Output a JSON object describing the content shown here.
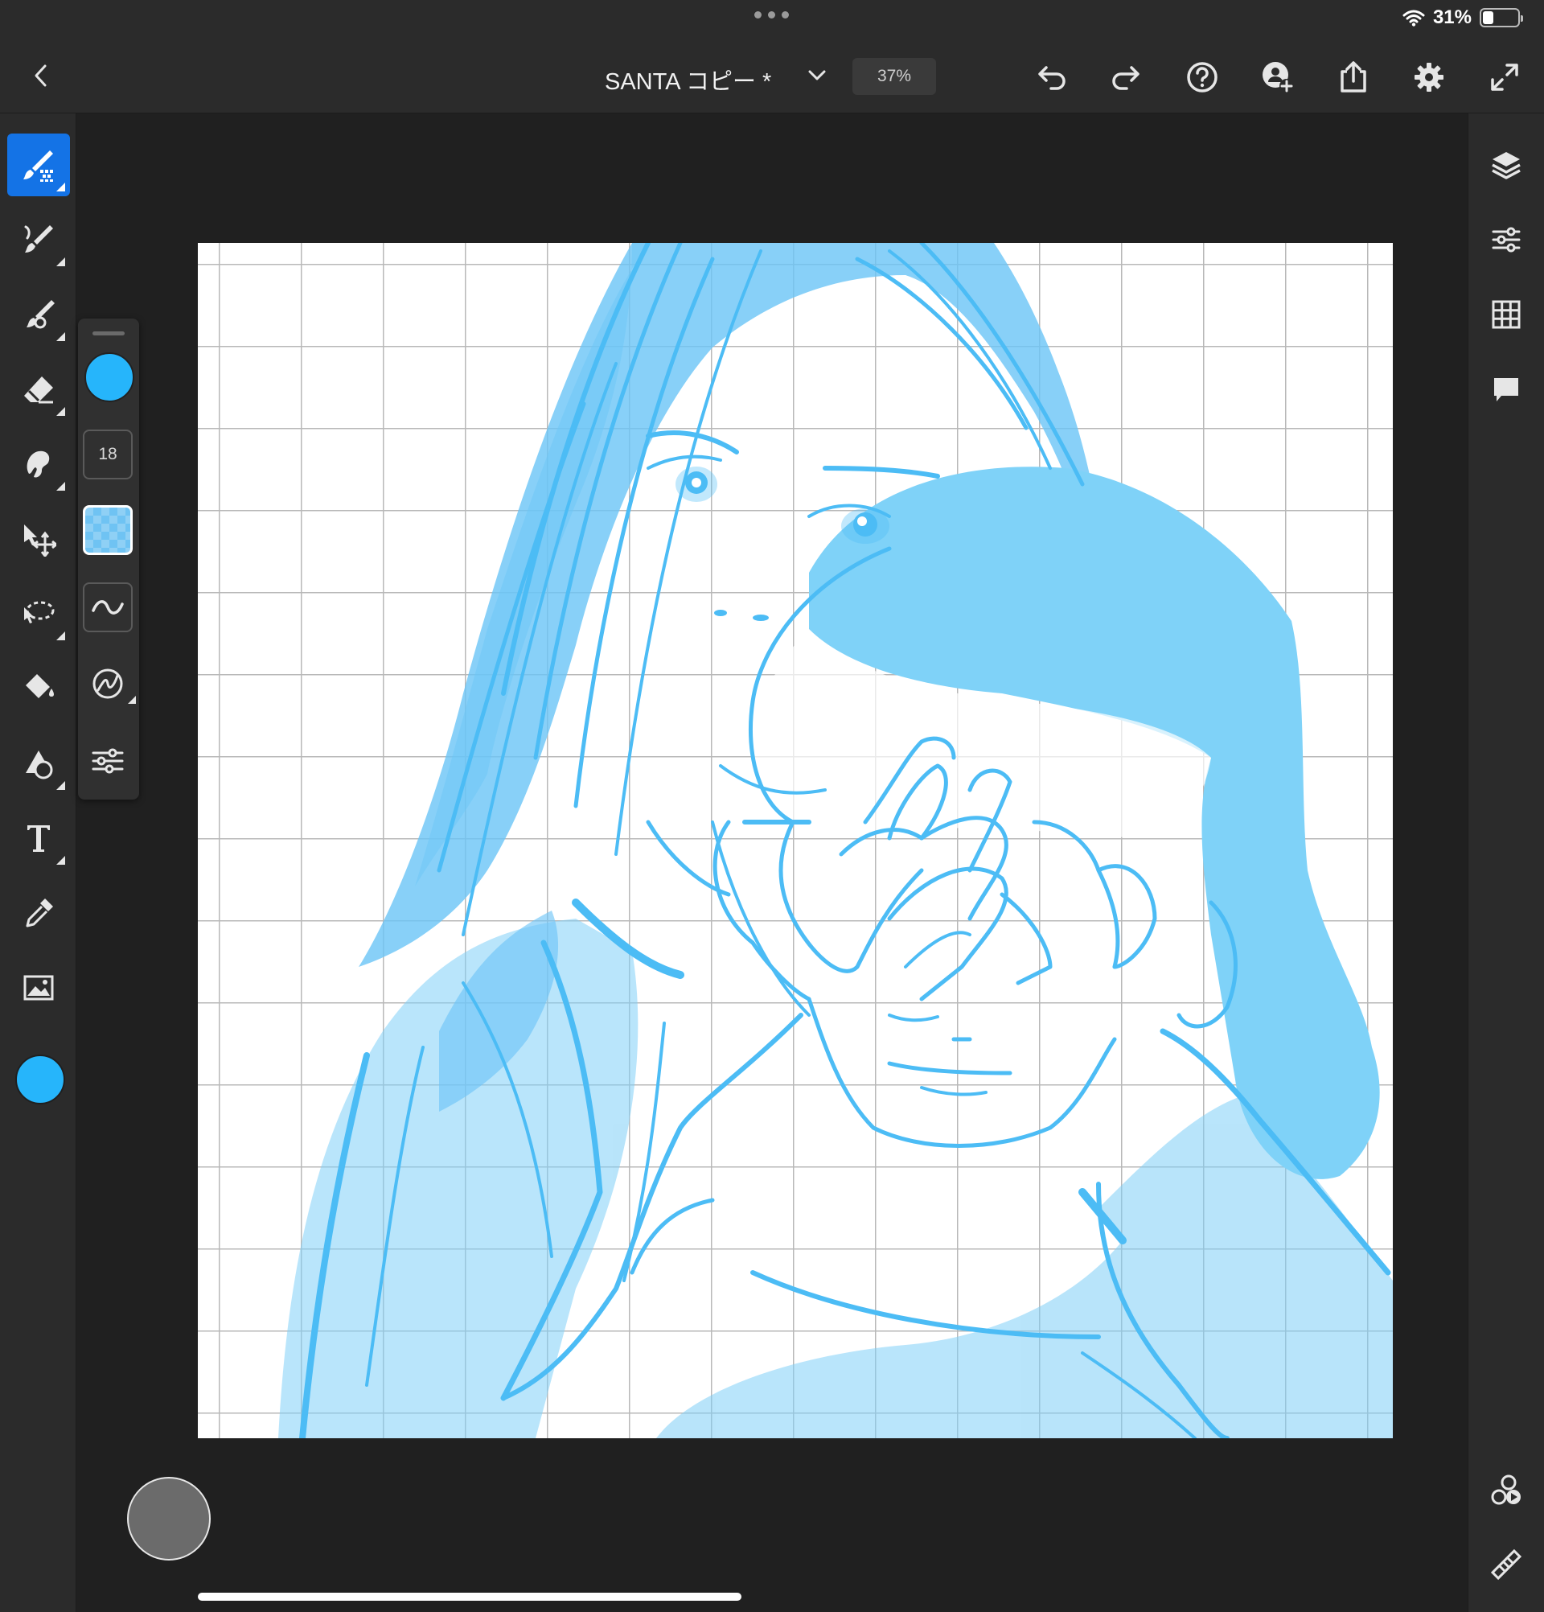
{
  "status": {
    "battery": "31%",
    "battery_level": 0.31
  },
  "header": {
    "title": "SANTA コピー *",
    "zoom": "37%"
  },
  "brush_panel": {
    "size": "18"
  },
  "colors": {
    "brush": "#26b5fb",
    "accent": "#1473e6",
    "sketch": "#4cbcf5"
  }
}
